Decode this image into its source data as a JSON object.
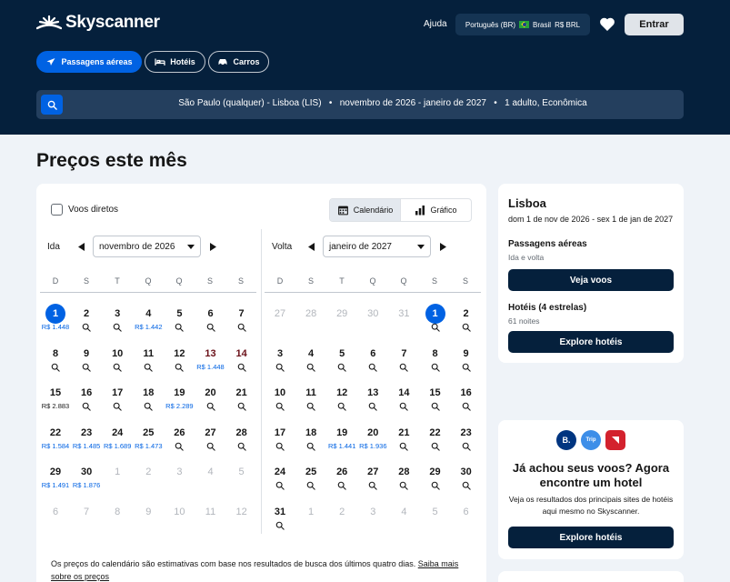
{
  "header": {
    "brand": "Skyscanner",
    "help": "Ajuda",
    "locale": {
      "language": "Português (BR)",
      "country": "Brasil",
      "currency": "R$ BRL"
    },
    "login": "Entrar",
    "tabs": [
      {
        "label": "Passagens aéreas",
        "icon": "plane-icon",
        "active": true
      },
      {
        "label": "Hotéis",
        "icon": "bed-icon",
        "active": false
      },
      {
        "label": "Carros",
        "icon": "car-icon",
        "active": false
      }
    ],
    "search_summary": "São Paulo (qualquer) - Lisboa (LIS)   •   novembro de 2026 - janeiro de 2027   •   1 adulto, Econômica"
  },
  "main": {
    "title": "Preços este mês",
    "direct_only": "Voos diretos",
    "view_toggle": {
      "calendar": "Calendário",
      "chart": "Gráfico"
    },
    "outbound": {
      "label": "Ida",
      "month": "novembro de 2026",
      "weekdays": [
        "D",
        "S",
        "T",
        "Q",
        "Q",
        "S",
        "S"
      ],
      "days": [
        {
          "d": "1",
          "price": "R$ 1.448",
          "sel": true
        },
        {
          "d": "2",
          "search": true
        },
        {
          "d": "3",
          "search": true
        },
        {
          "d": "4",
          "price": "R$ 1.442"
        },
        {
          "d": "5",
          "search": true
        },
        {
          "d": "6",
          "search": true
        },
        {
          "d": "7",
          "search": true
        },
        {
          "d": "8",
          "search": true
        },
        {
          "d": "9",
          "search": true
        },
        {
          "d": "10",
          "search": true
        },
        {
          "d": "11",
          "search": true
        },
        {
          "d": "12",
          "search": true
        },
        {
          "d": "13",
          "price": "R$ 1.448",
          "red": true
        },
        {
          "d": "14",
          "search": true,
          "red": true
        },
        {
          "d": "15",
          "price": "R$ 2.883",
          "black": true
        },
        {
          "d": "16",
          "search": true
        },
        {
          "d": "17",
          "search": true
        },
        {
          "d": "18",
          "search": true
        },
        {
          "d": "19",
          "price": "R$ 2.289"
        },
        {
          "d": "20",
          "search": true
        },
        {
          "d": "21",
          "search": true
        },
        {
          "d": "22",
          "price": "R$ 1.584"
        },
        {
          "d": "23",
          "price": "R$ 1.485"
        },
        {
          "d": "24",
          "price": "R$ 1.689"
        },
        {
          "d": "25",
          "price": "R$ 1.473"
        },
        {
          "d": "26",
          "search": true
        },
        {
          "d": "27",
          "search": true
        },
        {
          "d": "28",
          "search": true
        },
        {
          "d": "29",
          "price": "R$ 1.491"
        },
        {
          "d": "30",
          "price": "R$ 1.876"
        },
        {
          "d": "1",
          "muted": true
        },
        {
          "d": "2",
          "muted": true
        },
        {
          "d": "3",
          "muted": true
        },
        {
          "d": "4",
          "muted": true
        },
        {
          "d": "5",
          "muted": true
        },
        {
          "d": "6",
          "muted": true
        },
        {
          "d": "7",
          "muted": true
        },
        {
          "d": "8",
          "muted": true
        },
        {
          "d": "9",
          "muted": true
        },
        {
          "d": "10",
          "muted": true
        },
        {
          "d": "11",
          "muted": true
        },
        {
          "d": "12",
          "muted": true
        }
      ]
    },
    "return": {
      "label": "Volta",
      "month": "janeiro de 2027",
      "weekdays": [
        "D",
        "S",
        "T",
        "Q",
        "Q",
        "S",
        "S"
      ],
      "days": [
        {
          "d": "27",
          "muted": true
        },
        {
          "d": "28",
          "muted": true
        },
        {
          "d": "29",
          "muted": true
        },
        {
          "d": "30",
          "muted": true
        },
        {
          "d": "31",
          "muted": true
        },
        {
          "d": "1",
          "sel": true,
          "search": true
        },
        {
          "d": "2",
          "search": true
        },
        {
          "d": "3",
          "search": true
        },
        {
          "d": "4",
          "search": true
        },
        {
          "d": "5",
          "search": true
        },
        {
          "d": "6",
          "search": true
        },
        {
          "d": "7",
          "search": true
        },
        {
          "d": "8",
          "search": true
        },
        {
          "d": "9",
          "search": true
        },
        {
          "d": "10",
          "search": true
        },
        {
          "d": "11",
          "search": true
        },
        {
          "d": "12",
          "search": true
        },
        {
          "d": "13",
          "search": true
        },
        {
          "d": "14",
          "search": true
        },
        {
          "d": "15",
          "search": true
        },
        {
          "d": "16",
          "search": true
        },
        {
          "d": "17",
          "search": true
        },
        {
          "d": "18",
          "search": true
        },
        {
          "d": "19",
          "price": "R$ 1.441"
        },
        {
          "d": "20",
          "price": "R$ 1.936"
        },
        {
          "d": "21",
          "search": true
        },
        {
          "d": "22",
          "search": true
        },
        {
          "d": "23",
          "search": true
        },
        {
          "d": "24",
          "search": true
        },
        {
          "d": "25",
          "search": true
        },
        {
          "d": "26",
          "search": true
        },
        {
          "d": "27",
          "search": true
        },
        {
          "d": "28",
          "search": true
        },
        {
          "d": "29",
          "search": true
        },
        {
          "d": "30",
          "search": true
        },
        {
          "d": "31",
          "search": true
        },
        {
          "d": "1",
          "muted": true
        },
        {
          "d": "2",
          "muted": true
        },
        {
          "d": "3",
          "muted": true
        },
        {
          "d": "4",
          "muted": true
        },
        {
          "d": "5",
          "muted": true
        },
        {
          "d": "6",
          "muted": true
        }
      ]
    },
    "footnote": "Os preços do calendário são estimativas com base nos resultados de busca dos últimos quatro dias.",
    "footnote_link": "Saiba mais sobre os preços"
  },
  "sidebar": {
    "city": "Lisboa",
    "dates": "dom 1 de nov de 2026 - sex 1 de jan de 2027",
    "flights_heading": "Passagens aéreas",
    "flights_sub": "Ida e volta",
    "flights_button": "Veja voos",
    "hotels_heading": "Hotéis (4 estrelas)",
    "hotels_sub": "61 noites",
    "hotels_button": "Explore hotéis"
  },
  "hotel_promo": {
    "partners": [
      {
        "label": "B.",
        "color": "#003580"
      },
      {
        "label": "Trip",
        "color": "#3d8ee8"
      },
      {
        "label": "",
        "color": "#d3222e"
      }
    ],
    "title": "Já achou seus voos? Agora encontre um hotel",
    "subtitle": "Veja os resultados dos principais sites de hotéis aqui mesmo no Skyscanner.",
    "button": "Explore hotéis"
  },
  "colors": {
    "brand_dark": "#05203c",
    "accent": "#0062e3",
    "background": "#eff3f8"
  }
}
